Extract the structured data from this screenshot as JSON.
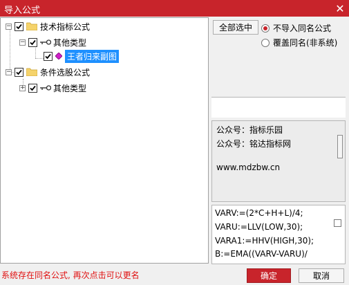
{
  "window": {
    "title": "导入公式",
    "close_glyph": "✕"
  },
  "tree": {
    "nodes": [
      {
        "label": "技术指标公式"
      },
      {
        "label": "其他类型"
      },
      {
        "label": "王者归来副图"
      },
      {
        "label": "条件选股公式"
      },
      {
        "label": "其他类型"
      }
    ],
    "expand_minus": "−",
    "expand_plus": "+"
  },
  "right": {
    "select_all_label": "全部选中",
    "radio_options": [
      {
        "label": "不导入同名公式",
        "selected": true
      },
      {
        "label": "覆盖同名(非系统)",
        "selected": false
      }
    ]
  },
  "info": {
    "lines": [
      "公众号：指标乐园",
      "公众号：铭达指标网",
      "",
      "www.mdzbw.cn"
    ]
  },
  "code": {
    "lines": [
      "VARV:=(2*C+H+L)/4;",
      "VARU:=LLV(LOW,30);",
      "VARA1:=HHV(HIGH,30);",
      "B:=EMA((VARV-VARU)/"
    ]
  },
  "footer": {
    "status_text": "系统存在同名公式, 再次点击可以更名",
    "ok_label": "确定",
    "cancel_label": "取消"
  },
  "colors": {
    "accent": "#c8242b",
    "selection": "#1e90ff",
    "status": "#e01010"
  }
}
